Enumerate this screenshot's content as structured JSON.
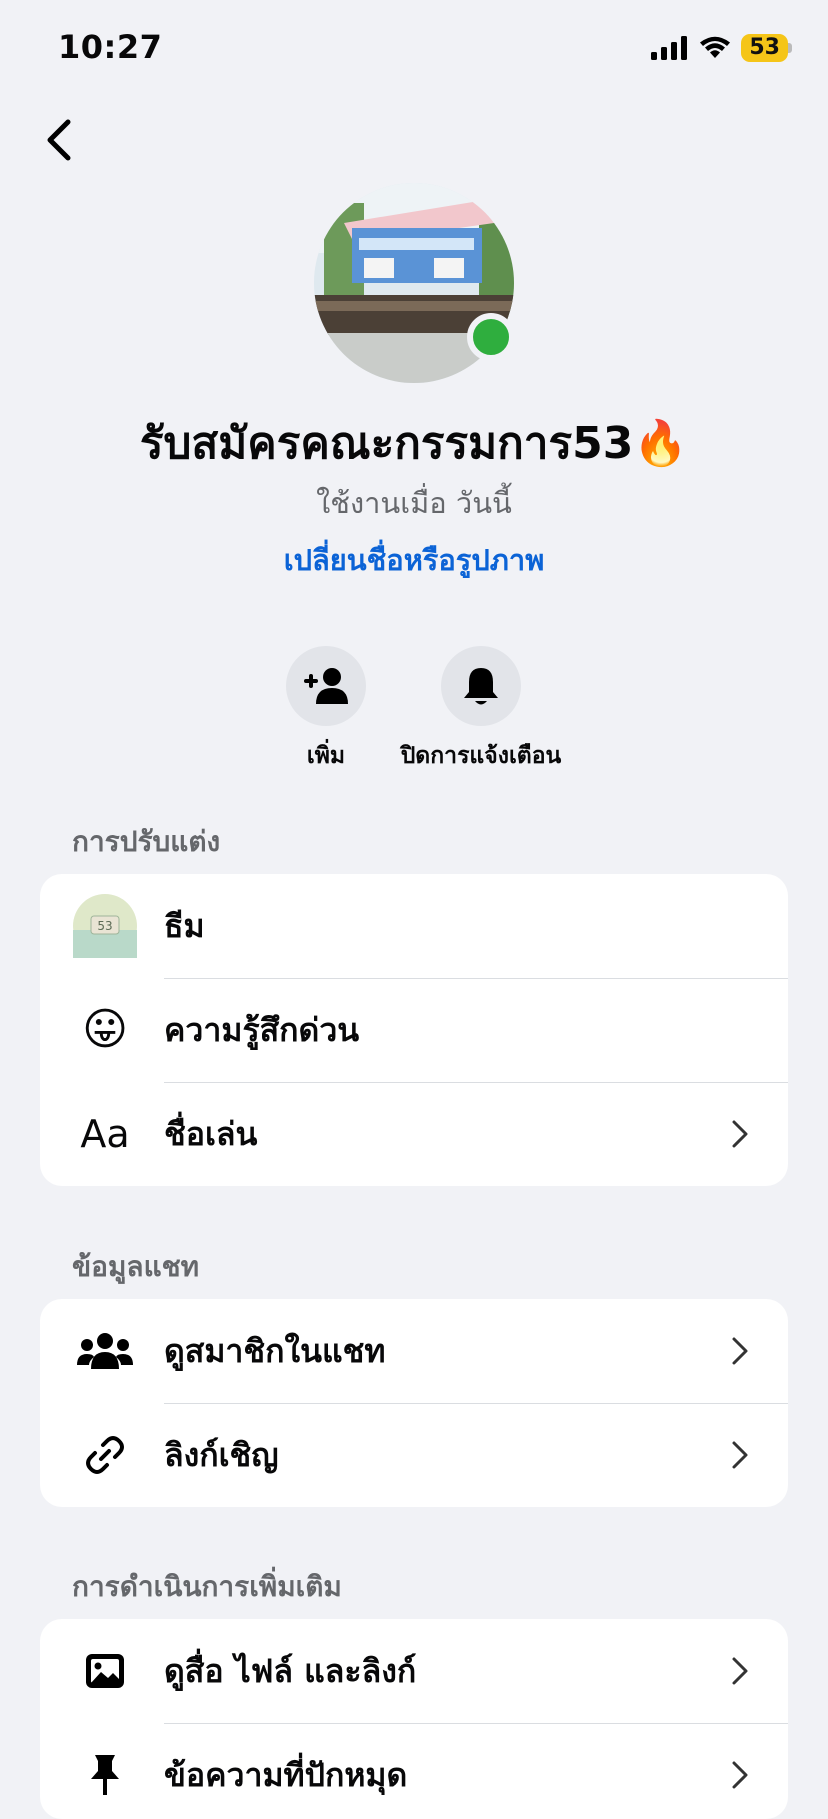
{
  "status_bar": {
    "time": "10:27",
    "battery": "53"
  },
  "header": {
    "title": "รับสมัครคณะกรรมการ53🔥",
    "subtitle": "ใช้งานเมื่อ วันนี้",
    "change_link": "เปลี่ยนชื่อหรือรูปภาพ"
  },
  "actions": [
    {
      "label": "เพิ่ม",
      "icon": "add-person-icon"
    },
    {
      "label": "ปิดการแจ้งเตือน",
      "icon": "bell-icon"
    }
  ],
  "sections": [
    {
      "title": "การปรับแต่ง",
      "items": [
        {
          "label": "ธีม",
          "icon": "theme-thumbnail",
          "chevron": false
        },
        {
          "label": "ความรู้สึกด่วน",
          "icon": "emoji-tongue-icon",
          "emoji": "😛",
          "chevron": false
        },
        {
          "label": "ชื่อเล่น",
          "icon": "text-aa-icon",
          "glyph": "Aa",
          "chevron": true
        }
      ]
    },
    {
      "title": "ข้อมูลแชท",
      "items": [
        {
          "label": "ดูสมาชิกในแชท",
          "icon": "people-icon",
          "chevron": true
        },
        {
          "label": "ลิงก์เชิญ",
          "icon": "link-icon",
          "chevron": true
        }
      ]
    },
    {
      "title": "การดำเนินการเพิ่มเติม",
      "items": [
        {
          "label": "ดูสื่อ ไฟล์ และลิงก์",
          "icon": "image-icon",
          "chevron": true
        },
        {
          "label": "ข้อความที่ปักหมุด",
          "icon": "pin-icon",
          "chevron": true
        }
      ]
    }
  ],
  "colors": {
    "accent": "#0b63d6",
    "online": "#2fae3e",
    "background": "#f1f2f6",
    "battery": "#f5c518"
  }
}
